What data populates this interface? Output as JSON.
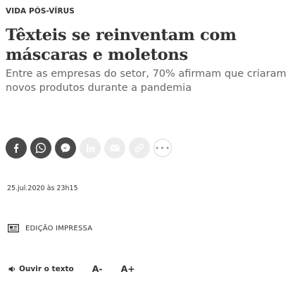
{
  "article": {
    "kicker": "VIDA PÓS-VÍRUS",
    "headline": "Têxteis se reinventam com máscaras e moletons",
    "subtitle": "Entre as empresas do setor, 70% afirmam que criaram novos produtos durante a pandemia",
    "date": "25.jul.2020 às 23h15"
  },
  "share": {
    "buttons": [
      "facebook-icon",
      "whatsapp-icon",
      "messenger-icon",
      "linkedin-icon",
      "email-icon",
      "copy-link-icon",
      "more-icon"
    ],
    "more_label": "•••"
  },
  "edition": {
    "label": "EDIÇÃO IMPRESSA",
    "icon": "newspaper-icon"
  },
  "audio": {
    "listen_label": "Ouvir o texto",
    "decrease_font_label": "A-",
    "increase_font_label": "A+"
  },
  "colors": {
    "text": "#333333",
    "subtitle": "#666666",
    "share_dark": "#4a4a4a",
    "share_light": "#ececec"
  }
}
